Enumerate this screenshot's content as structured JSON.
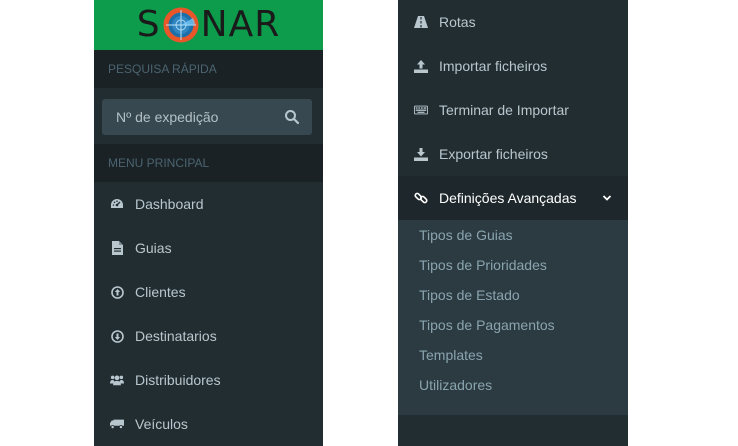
{
  "left_panel": {
    "logo": {
      "letters_before": "S",
      "letters_after": "NAR",
      "colors": {
        "bar": "#0d9b4c",
        "ring": "#e8562a"
      }
    },
    "search_section_label": "PESQUISA RÁPIDA",
    "search": {
      "placeholder": "Nº de expedição",
      "icon": "search-icon"
    },
    "main_menu_label": "MENU PRINCIPAL",
    "menu": [
      {
        "label": "Dashboard",
        "icon": "dashboard-icon"
      },
      {
        "label": "Guias",
        "icon": "document-icon"
      },
      {
        "label": "Clientes",
        "icon": "arrow-circle-up-icon"
      },
      {
        "label": "Destinatarios",
        "icon": "arrow-circle-down-icon"
      },
      {
        "label": "Distribuidores",
        "icon": "users-icon"
      },
      {
        "label": "Veículos",
        "icon": "truck-icon"
      }
    ]
  },
  "right_panel": {
    "menu": [
      {
        "label": "Rotas",
        "icon": "road-icon"
      },
      {
        "label": "Importar ficheiros",
        "icon": "upload-icon"
      },
      {
        "label": "Terminar de Importar",
        "icon": "keyboard-icon"
      },
      {
        "label": "Exportar ficheiros",
        "icon": "download-icon"
      },
      {
        "label": "Definições Avançadas",
        "icon": "link-icon",
        "expanded": true
      }
    ],
    "submenu": [
      {
        "label": "Tipos de Guias"
      },
      {
        "label": "Tipos de Prioridades"
      },
      {
        "label": "Tipos de Estado"
      },
      {
        "label": "Tipos de Pagamentos"
      },
      {
        "label": "Templates"
      },
      {
        "label": "Utilizadores"
      }
    ]
  }
}
